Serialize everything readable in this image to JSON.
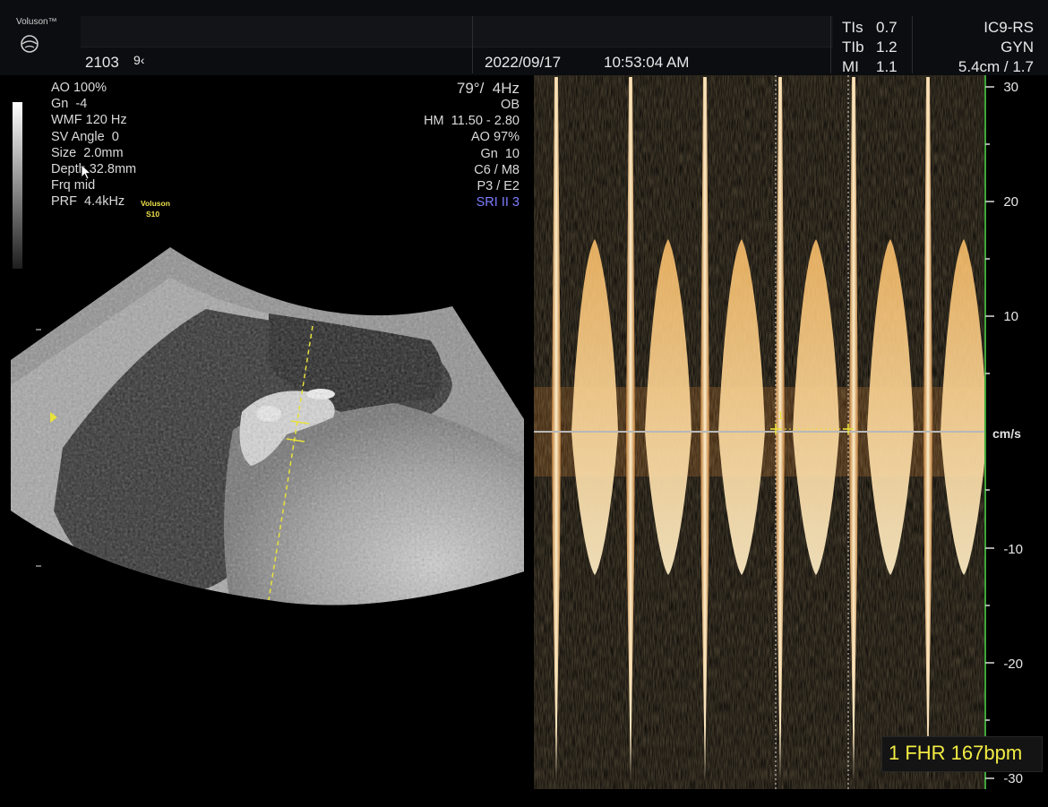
{
  "header": {
    "brand": "Voluson™",
    "patient_id": "2103",
    "patient_suffix": "9‹",
    "date": "2022/09/17",
    "time": "10:53:04 AM",
    "safety": [
      {
        "label": "TIs",
        "value": "0.7"
      },
      {
        "label": "TIb",
        "value": "1.2"
      },
      {
        "label": "MI",
        "value": "1.1"
      }
    ],
    "probe": "IC9-RS",
    "preset": "GYN",
    "depth_info": "5.4cm / 1.7"
  },
  "left_params": [
    "AO 100%",
    "Gn  -4",
    "WMF 120 Hz",
    "SV Angle  0",
    "Size  2.0mm",
    "Depth 32.8mm",
    "Frq mid",
    "PRF  4.4kHz"
  ],
  "voluson_badge": {
    "line1": "Voluson",
    "line2": "S10"
  },
  "right_params": [
    "79°/  4Hz",
    "OB",
    "HM  11.50 - 2.80",
    "AO 97%",
    "Gn  10",
    "C6 / M8",
    "P3 / E2"
  ],
  "right_params_highlight": "SRI II 3",
  "doppler": {
    "unit": "cm/s",
    "scale_labels": [
      "30",
      "20",
      "10",
      "-10",
      "-20",
      "-30"
    ],
    "caliper_label": "1"
  },
  "measurement": {
    "index": "1",
    "name": "FHR",
    "value": 167,
    "unit": "bpm",
    "text": "1 FHR 167bpm"
  },
  "colors": {
    "doppler_core": "#fff2d2",
    "doppler_mid": "#f2b25a",
    "doppler_edge": "#a9601a",
    "baseline": "#b8b8b8",
    "scale_line": "#3fa53a",
    "caliper": "#e9e23a",
    "measurement_text": "#f2ec43"
  }
}
